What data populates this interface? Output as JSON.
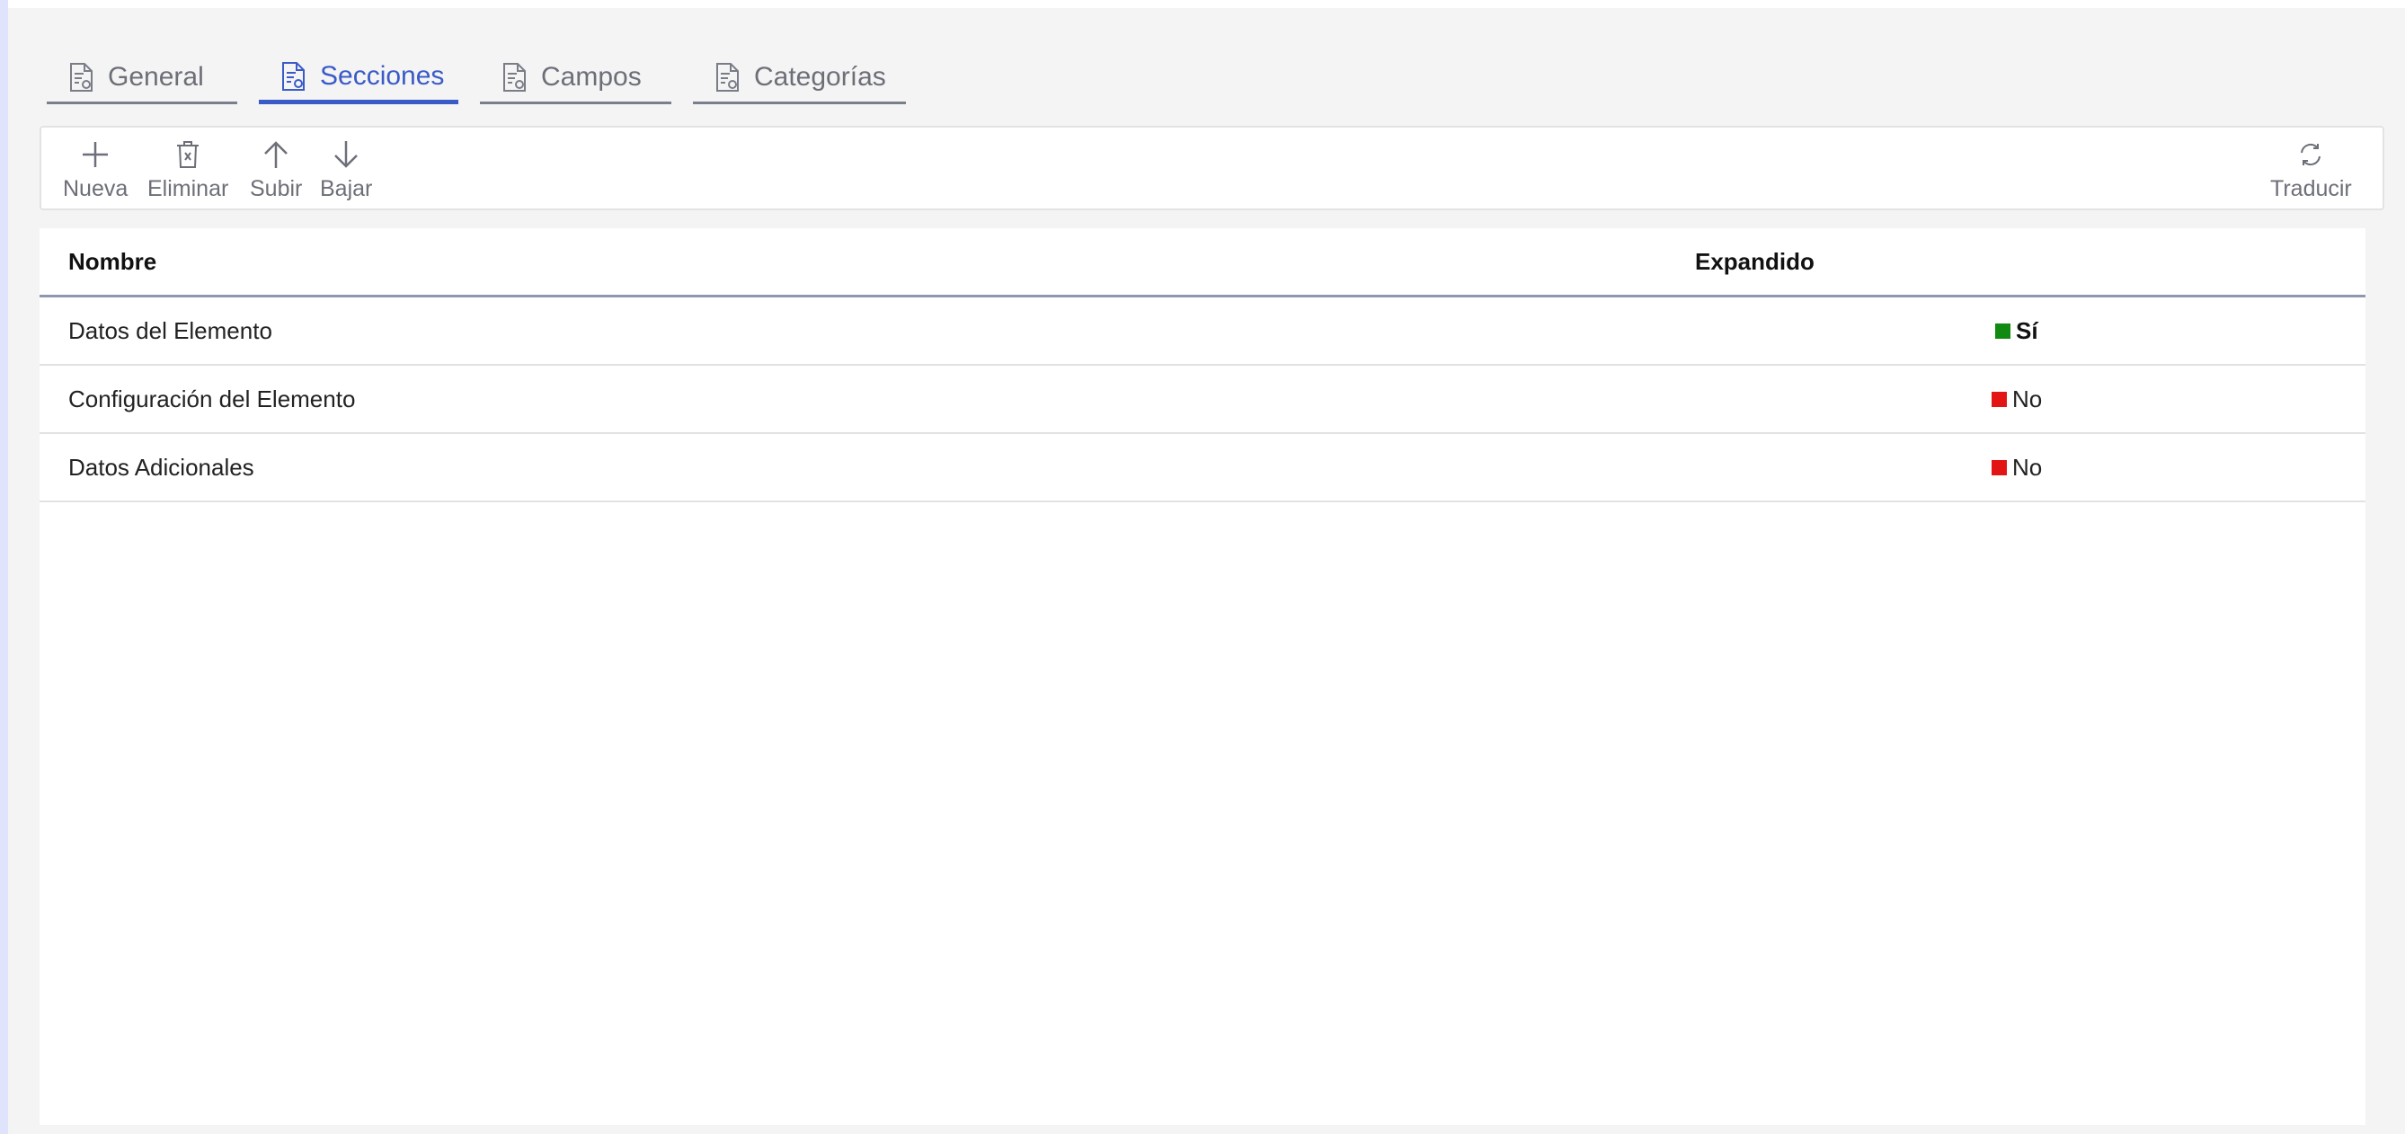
{
  "tabs": [
    {
      "label": "General",
      "icon": "document-settings-icon",
      "active": false
    },
    {
      "label": "Secciones",
      "icon": "document-settings-icon",
      "active": true
    },
    {
      "label": "Campos",
      "icon": "document-settings-icon",
      "active": false
    },
    {
      "label": "Categorías",
      "icon": "document-settings-icon",
      "active": false
    }
  ],
  "toolbar": {
    "nueva": "Nueva",
    "eliminar": "Eliminar",
    "subir": "Subir",
    "bajar": "Bajar",
    "traducir": "Traducir"
  },
  "grid": {
    "columns": [
      "Nombre",
      "Expandido"
    ],
    "rows": [
      {
        "nombre": "Datos del Elemento",
        "expandido": "Sí",
        "status_color": "#118a11"
      },
      {
        "nombre": "Configuración del Elemento",
        "expandido": "No",
        "status_color": "#e31414"
      },
      {
        "nombre": "Datos Adicionales",
        "expandido": "No",
        "status_color": "#e31414"
      }
    ]
  },
  "colors": {
    "accent": "#3a5bc7",
    "tab_inactive": "#6d6f78",
    "yes": "#118a11",
    "no": "#e31414"
  }
}
